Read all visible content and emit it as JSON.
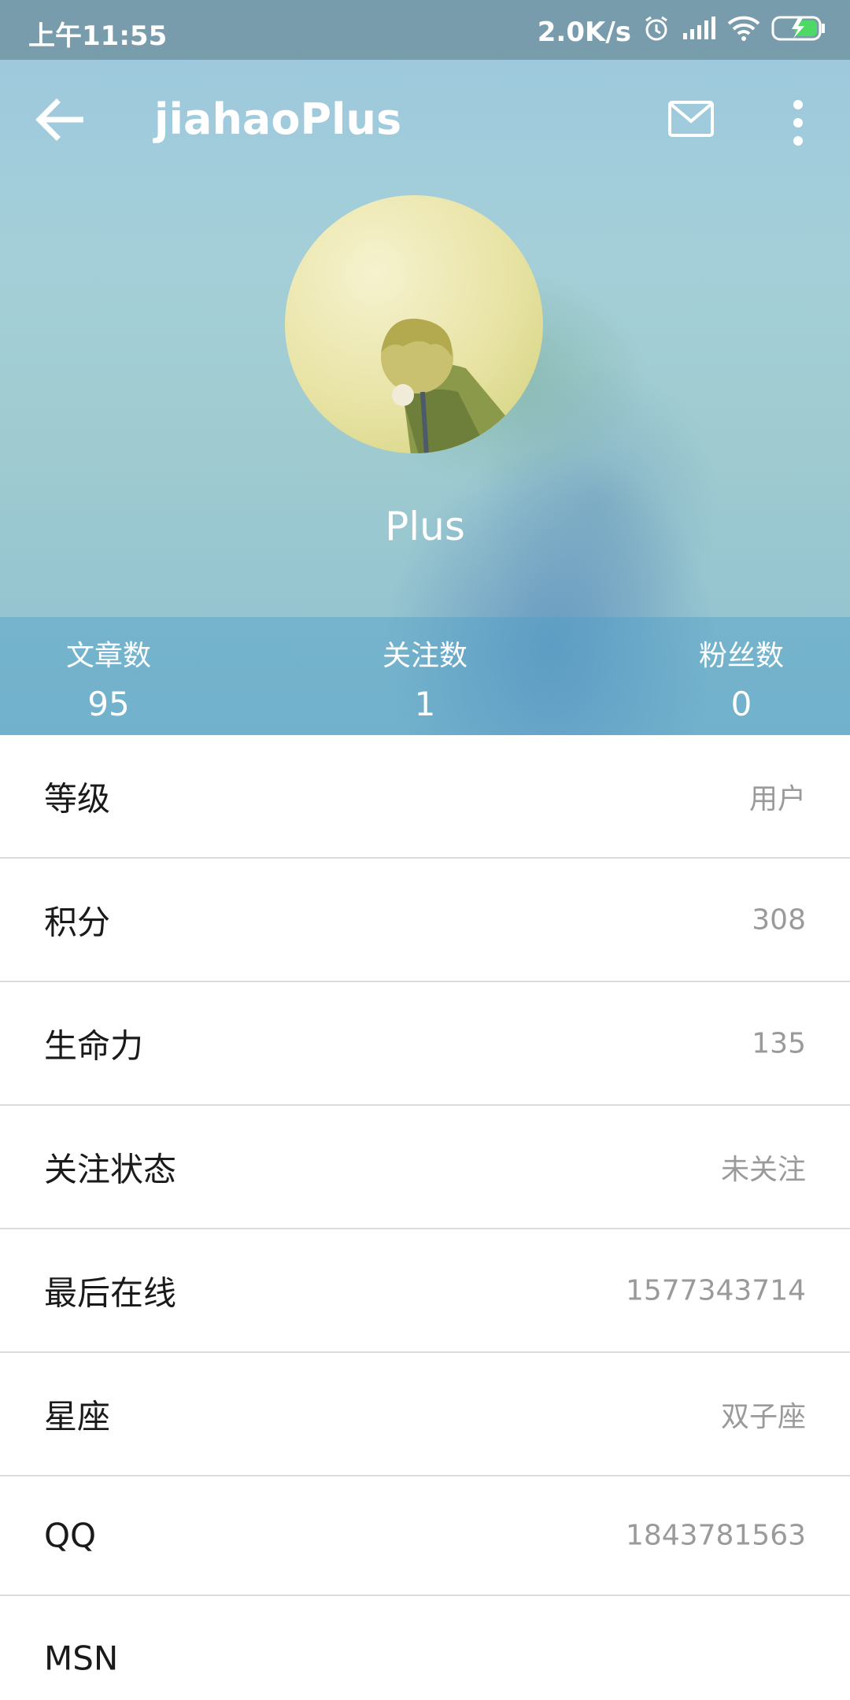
{
  "status_bar": {
    "time": "上午11:55",
    "speed": "2.0K/s",
    "icons": [
      "alarm-icon",
      "signal-icon",
      "wifi-icon",
      "battery-charging-icon"
    ]
  },
  "toolbar": {
    "title": "jiahaoPlus",
    "icons": [
      "back-arrow-icon",
      "mail-icon",
      "more-vert-icon"
    ]
  },
  "profile": {
    "name": "Plus"
  },
  "stats": [
    {
      "label": "文章数",
      "value": "95"
    },
    {
      "label": "关注数",
      "value": "1"
    },
    {
      "label": "粉丝数",
      "value": "0"
    }
  ],
  "info_rows": [
    {
      "key": "等级",
      "value": "用户"
    },
    {
      "key": "积分",
      "value": "308"
    },
    {
      "key": "生命力",
      "value": "135"
    },
    {
      "key": "关注状态",
      "value": "未关注"
    },
    {
      "key": "最后在线",
      "value": "1577343714"
    },
    {
      "key": "星座",
      "value": "双子座"
    },
    {
      "key": "QQ",
      "value": "1843781563"
    },
    {
      "key": "MSN",
      "value": ""
    }
  ],
  "colors": {
    "header_bg": "#9cc7df",
    "stats_bar": "#6fb3d0",
    "divider": "#dcdcdc",
    "value_text": "#9a9a9a"
  }
}
